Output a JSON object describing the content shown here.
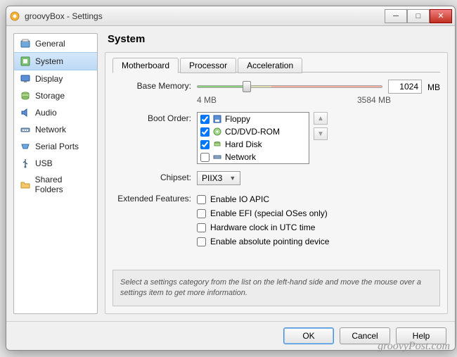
{
  "window": {
    "title": "groovyBox - Settings"
  },
  "sidebar": {
    "items": [
      {
        "label": "General"
      },
      {
        "label": "System"
      },
      {
        "label": "Display"
      },
      {
        "label": "Storage"
      },
      {
        "label": "Audio"
      },
      {
        "label": "Network"
      },
      {
        "label": "Serial Ports"
      },
      {
        "label": "USB"
      },
      {
        "label": "Shared Folders"
      }
    ],
    "selected": 1
  },
  "main": {
    "heading": "System",
    "tabs": [
      {
        "label": "Motherboard"
      },
      {
        "label": "Processor"
      },
      {
        "label": "Acceleration"
      }
    ],
    "active_tab": 0,
    "base_memory": {
      "label": "Base Memory:",
      "value": "1024",
      "unit": "MB",
      "min_label": "4 MB",
      "max_label": "3584 MB"
    },
    "boot_order": {
      "label": "Boot Order:",
      "items": [
        {
          "label": "Floppy",
          "checked": true
        },
        {
          "label": "CD/DVD-ROM",
          "checked": true
        },
        {
          "label": "Hard Disk",
          "checked": true
        },
        {
          "label": "Network",
          "checked": false
        }
      ]
    },
    "chipset": {
      "label": "Chipset:",
      "value": "PIIX3"
    },
    "extended": {
      "label": "Extended Features:",
      "options": [
        {
          "label": "Enable IO APIC",
          "checked": false
        },
        {
          "label": "Enable EFI (special OSes only)",
          "checked": false
        },
        {
          "label": "Hardware clock in UTC time",
          "checked": false
        },
        {
          "label": "Enable absolute pointing device",
          "checked": false
        }
      ]
    },
    "hint": "Select a settings category from the list on the left-hand side and move the mouse over a settings item to get more information."
  },
  "footer": {
    "ok": "OK",
    "cancel": "Cancel",
    "help": "Help"
  },
  "watermark": "groovyPost.com"
}
